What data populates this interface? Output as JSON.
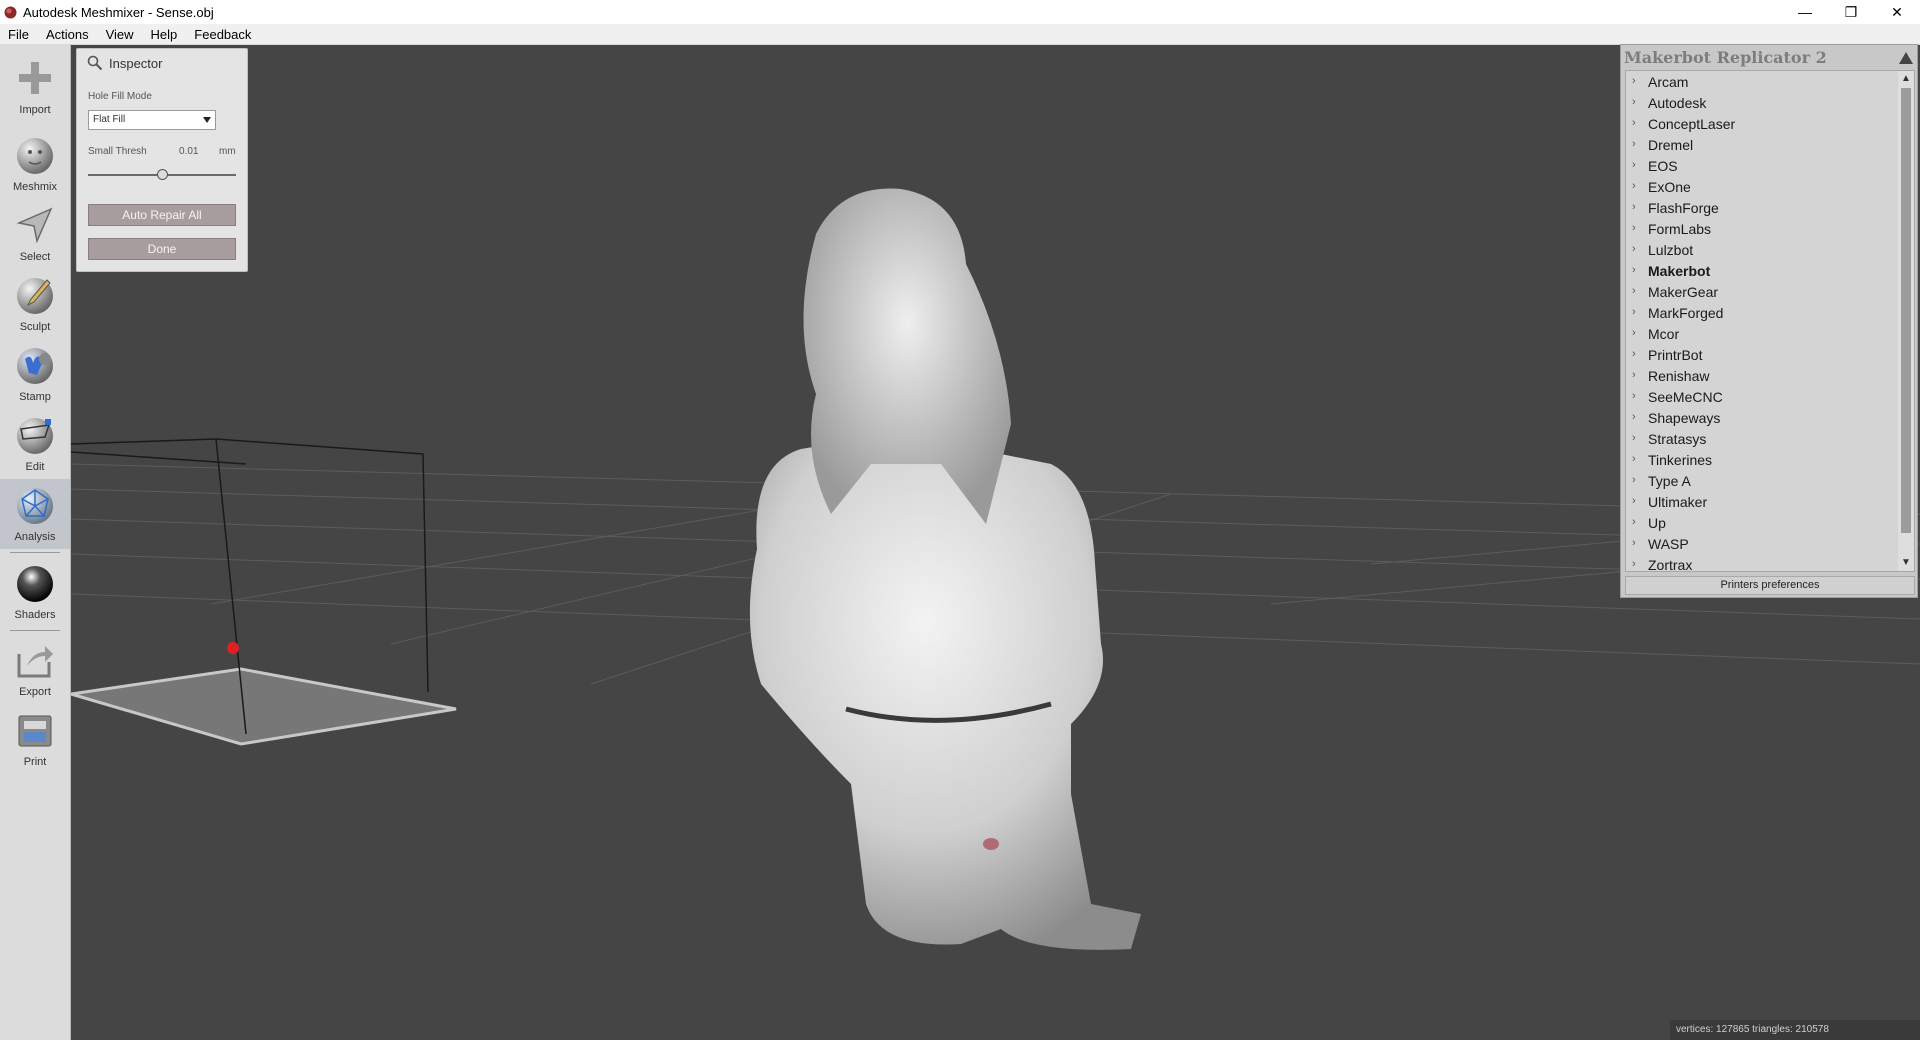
{
  "window": {
    "title": "Autodesk Meshmixer - Sense.obj",
    "minimize": "—",
    "restore": "❐",
    "close": "✕"
  },
  "menu": [
    "File",
    "Actions",
    "View",
    "Help",
    "Feedback"
  ],
  "tools": [
    {
      "label": "Import",
      "icon": "plus-icon"
    },
    {
      "label": "Meshmix",
      "icon": "meshmix-icon"
    },
    {
      "label": "Select",
      "icon": "select-arrow-icon"
    },
    {
      "label": "Sculpt",
      "icon": "sculpt-brush-icon"
    },
    {
      "label": "Stamp",
      "icon": "stamp-icon"
    },
    {
      "label": "Edit",
      "icon": "edit-icon"
    },
    {
      "label": "Analysis",
      "icon": "analysis-icon"
    },
    {
      "label": "Shaders",
      "icon": "shader-sphere-icon"
    },
    {
      "label": "Export",
      "icon": "export-icon"
    },
    {
      "label": "Print",
      "icon": "printer-icon"
    }
  ],
  "inspector": {
    "title": "Inspector",
    "hole_fill_label": "Hole Fill Mode",
    "hole_fill_value": "Flat Fill",
    "thresh_label": "Small Thresh",
    "thresh_value": "0.01",
    "thresh_unit": "mm",
    "slider_fraction": 0.5,
    "auto_repair": "Auto Repair All",
    "done": "Done"
  },
  "printers": {
    "title": "Makerbot Replicator 2",
    "selected": "Makerbot",
    "items": [
      "Arcam",
      "Autodesk",
      "ConceptLaser",
      "Dremel",
      "EOS",
      "ExOne",
      "FlashForge",
      "FormLabs",
      "Lulzbot",
      "Makerbot",
      "MakerGear",
      "MarkForged",
      "Mcor",
      "PrintrBot",
      "Renishaw",
      "SeeMeCNC",
      "Shapeways",
      "Stratasys",
      "Tinkerines",
      "Type A",
      "Ultimaker",
      "Up",
      "WASP",
      "Zortrax"
    ],
    "preferences": "Printers preferences"
  },
  "status": "vertices: 127865 triangles: 210578"
}
